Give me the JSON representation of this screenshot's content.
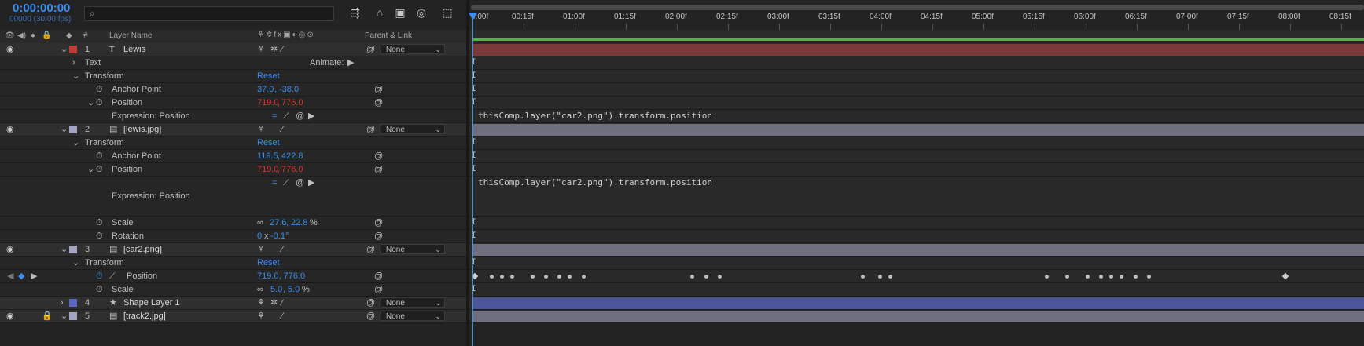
{
  "header": {
    "timecode": "0:00:00:00",
    "fps": "00000 (30.00 fps)",
    "search_placeholder": "",
    "columns": {
      "hash": "#",
      "layer_name": "Layer Name",
      "parent_link": "Parent & Link"
    },
    "toolbar_icons": [
      "comp-flowchart-icon",
      "draft-3d-icon",
      "shy-icon",
      "frame-blending-icon",
      "motion-blur-icon",
      "graph-editor-icon"
    ]
  },
  "timeline": {
    "ruler_labels": [
      "0:00f",
      "00:15f",
      "01:00f",
      "01:15f",
      "02:00f",
      "02:15f",
      "03:00f",
      "03:15f",
      "04:00f",
      "04:15f",
      "05:00f",
      "05:15f",
      "06:00f",
      "06:15f",
      "07:00f",
      "07:15f",
      "08:00f",
      "08:15f"
    ],
    "expression_text_1": "thisComp.layer(\"car2.png\").transform.position",
    "expression_text_2": "thisComp.layer(\"car2.png\").transform.position",
    "keyframe_times": [
      "0:00f",
      "00:05f",
      "00:08f",
      "00:11f",
      "00:17f",
      "00:21f",
      "00:25f",
      "00:28f",
      "01:02f",
      "02:04f",
      "02:08f",
      "02:12f",
      "03:24f",
      "03:29f",
      "04:02f",
      "05:18f",
      "05:24f",
      "06:00f",
      "06:04f",
      "06:07f",
      "06:10f",
      "06:14f",
      "06:18f",
      "07:28f"
    ]
  },
  "layers": [
    {
      "num": "1",
      "name": "Lewis",
      "type": "text",
      "color": "#c03a36",
      "parent": "None",
      "bar_color": "#7a3a39"
    },
    {
      "num": "2",
      "name": "[lewis.jpg]",
      "type": "footage",
      "color": "#a4a4c2",
      "parent": "None",
      "bar_color": "#6f6f7f"
    },
    {
      "num": "3",
      "name": "[car2.png]",
      "type": "footage",
      "color": "#a4a4c2",
      "parent": "None",
      "bar_color": "#6f6f7f"
    },
    {
      "num": "4",
      "name": "Shape Layer 1",
      "type": "shape",
      "color": "#5b68c2",
      "parent": "None",
      "bar_color": "#4b5597"
    },
    {
      "num": "5",
      "name": "[track2.jpg]",
      "type": "footage",
      "color": "#a4a4c2",
      "parent": "None",
      "bar_color": "#6f6f7f"
    }
  ],
  "props": {
    "text": "Text",
    "animate": "Animate:",
    "transform": "Transform",
    "reset": "Reset",
    "anchor_point": "Anchor Point",
    "position": "Position",
    "expression_position": "Expression: Position",
    "scale": "Scale",
    "rotation": "Rotation",
    "l1_anchor_x": "37.0",
    "l1_anchor_y": "-38.0",
    "l1_pos_x": "719.0",
    "l1_pos_y": "776.0",
    "l2_anchor_x": "119.5",
    "l2_anchor_y": "422.8",
    "l2_pos_x": "719.0",
    "l2_pos_y": "776.0",
    "l2_scale_x": "27.6",
    "l2_scale_y": "22.8",
    "l2_scale_unit": "%",
    "l2_rot_turns": "0",
    "l2_rot_x": "x",
    "l2_rot_deg": "-0.1°",
    "l3_pos": "719.0, 776.0",
    "l3_scale_x": "5.0",
    "l3_scale_y": "5.0",
    "l3_scale_unit": "%"
  }
}
